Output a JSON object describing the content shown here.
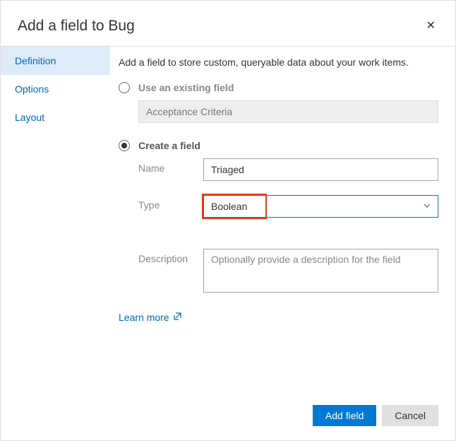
{
  "header": {
    "title": "Add a field to Bug"
  },
  "sidebar": {
    "items": [
      {
        "label": "Definition"
      },
      {
        "label": "Options"
      },
      {
        "label": "Layout"
      }
    ]
  },
  "content": {
    "intro": "Add a field to store custom, queryable data about your work items.",
    "existing": {
      "title": "Use an existing field",
      "value": "Acceptance Criteria"
    },
    "create": {
      "title": "Create a field",
      "name_label": "Name",
      "name_value": "Triaged",
      "type_label": "Type",
      "type_value": "Boolean",
      "description_label": "Description",
      "description_placeholder": "Optionally provide a description for the field"
    },
    "learn_more": "Learn more"
  },
  "footer": {
    "primary": "Add field",
    "secondary": "Cancel"
  }
}
